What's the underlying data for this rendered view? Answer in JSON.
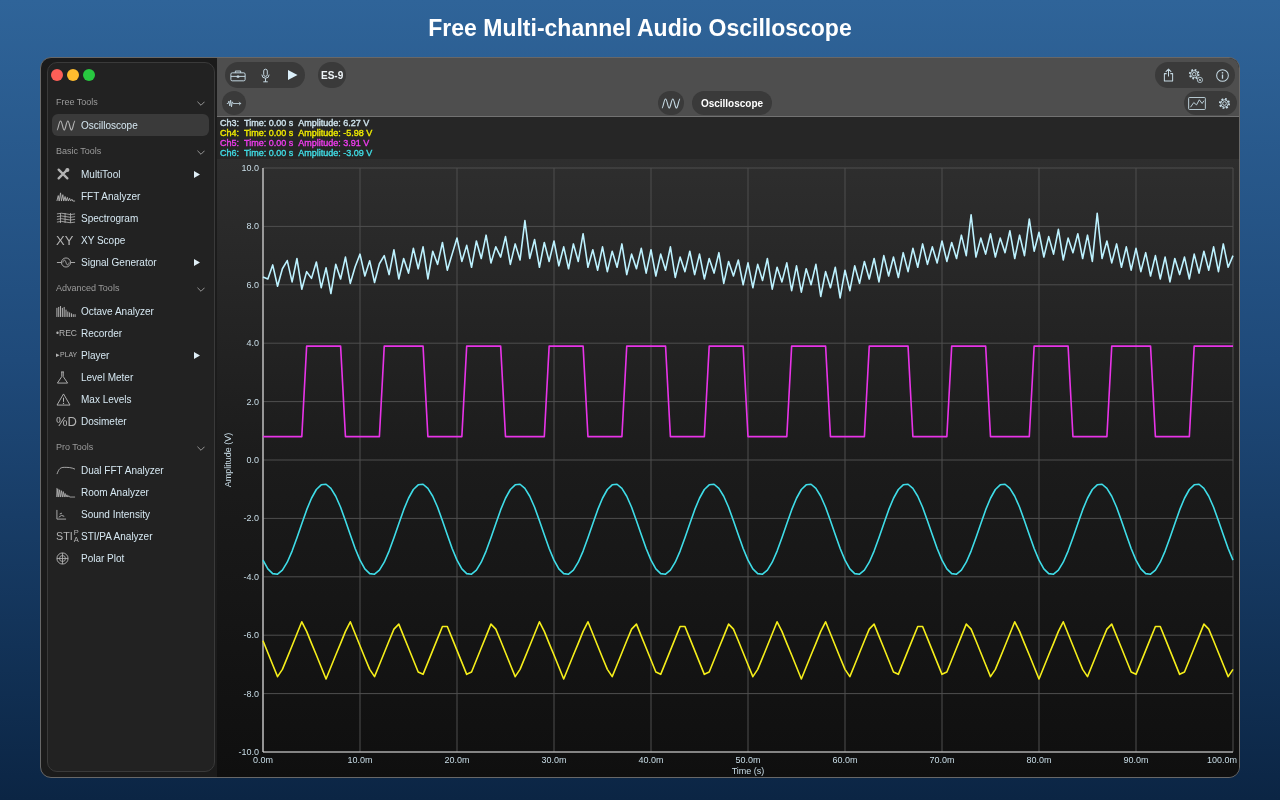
{
  "title": "Free Multi-channel Audio Oscilloscope",
  "sidebar": {
    "sections": [
      {
        "title": "Free Tools",
        "expanded": true,
        "items": [
          {
            "label": "Oscilloscope",
            "selected": true,
            "submenu": false
          }
        ]
      },
      {
        "title": "Basic Tools",
        "expanded": true,
        "items": [
          {
            "label": "MultiTool",
            "selected": false,
            "submenu": true
          },
          {
            "label": "FFT Analyzer",
            "selected": false,
            "submenu": false
          },
          {
            "label": "Spectrogram",
            "selected": false,
            "submenu": false
          },
          {
            "label": "XY Scope",
            "icon_text": "XY",
            "selected": false,
            "submenu": false
          },
          {
            "label": "Signal Generator",
            "selected": false,
            "submenu": true
          }
        ]
      },
      {
        "title": "Advanced Tools",
        "expanded": true,
        "items": [
          {
            "label": "Octave Analyzer",
            "selected": false,
            "submenu": false
          },
          {
            "label": "Recorder",
            "icon_text": "•REC",
            "selected": false,
            "submenu": false
          },
          {
            "label": "Player",
            "icon_text": "▸PLAY",
            "selected": false,
            "submenu": true
          },
          {
            "label": "Level Meter",
            "selected": false,
            "submenu": false
          },
          {
            "label": "Max Levels",
            "selected": false,
            "submenu": false
          },
          {
            "label": "Dosimeter",
            "icon_text": "%D",
            "selected": false,
            "submenu": false
          }
        ]
      },
      {
        "title": "Pro Tools",
        "expanded": true,
        "items": [
          {
            "label": "Dual FFT Analyzer",
            "selected": false,
            "submenu": false
          },
          {
            "label": "Room Analyzer",
            "selected": false,
            "submenu": false
          },
          {
            "label": "Sound Intensity",
            "selected": false,
            "submenu": false
          },
          {
            "label": "STI/PA Analyzer",
            "icon_text": "STI",
            "icon_text_small": "PA",
            "selected": false,
            "submenu": false
          },
          {
            "label": "Polar Plot",
            "selected": false,
            "submenu": false
          }
        ]
      }
    ]
  },
  "toolbar": {
    "device_button": "ES-9",
    "tool_title": "Oscilloscope"
  },
  "oscilloscope": {
    "readouts": [
      {
        "channel": "Ch3:",
        "time": "Time: 0.00 s",
        "amplitude": "Amplitude: 6.27 V",
        "color": "#cfe4ee"
      },
      {
        "channel": "Ch4:",
        "time": "Time: 0.00 s",
        "amplitude": "Amplitude: -5.98 V",
        "color": "#f0ec00"
      },
      {
        "channel": "Ch5:",
        "time": "Time: 0.00 s",
        "amplitude": "Amplitude: 3.91 V",
        "color": "#ee3cee"
      },
      {
        "channel": "Ch6:",
        "time": "Time: 0.00 s",
        "amplitude": "Amplitude: -3.09 V",
        "color": "#40dde6"
      }
    ],
    "chart_data": {
      "type": "line",
      "xlabel": "Time (s)",
      "ylabel": "Amplitude (V)",
      "grid": true,
      "xlim": [
        0,
        100
      ],
      "ylim": [
        -10,
        10
      ],
      "xticks": [
        {
          "value": 0,
          "label": "0.0m"
        },
        {
          "value": 10,
          "label": "10.0m"
        },
        {
          "value": 20,
          "label": "20.0m"
        },
        {
          "value": 30,
          "label": "30.0m"
        },
        {
          "value": 40,
          "label": "40.0m"
        },
        {
          "value": 50,
          "label": "50.0m"
        },
        {
          "value": 60,
          "label": "60.0m"
        },
        {
          "value": 70,
          "label": "70.0m"
        },
        {
          "value": 80,
          "label": "80.0m"
        },
        {
          "value": 90,
          "label": "90.0m"
        },
        {
          "value": 100,
          "label": "100.0m"
        }
      ],
      "yticks": [
        {
          "value": 10,
          "label": "10.0"
        },
        {
          "value": 8,
          "label": "8.0"
        },
        {
          "value": 6,
          "label": "6.0"
        },
        {
          "value": 4,
          "label": "4.0"
        },
        {
          "value": 2,
          "label": "2.0"
        },
        {
          "value": 0,
          "label": "0.0"
        },
        {
          "value": -2,
          "label": "-2.0"
        },
        {
          "value": -4,
          "label": "-4.0"
        },
        {
          "value": -6,
          "label": "-6.0"
        },
        {
          "value": -8,
          "label": "-8.0"
        },
        {
          "value": -10,
          "label": "-10.0"
        }
      ],
      "x": [
        0,
        0.5,
        1,
        1.5,
        2,
        2.5,
        3,
        3.5,
        4,
        4.5,
        5,
        5.5,
        6,
        6.5,
        7,
        7.5,
        8,
        8.5,
        9,
        9.5,
        10,
        10.5,
        11,
        11.5,
        12,
        12.5,
        13,
        13.5,
        14,
        14.5,
        15,
        15.5,
        16,
        16.5,
        17,
        17.5,
        18,
        18.5,
        19,
        19.5,
        20,
        20.5,
        21,
        21.5,
        22,
        22.5,
        23,
        23.5,
        24,
        24.5,
        25,
        25.5,
        26,
        26.5,
        27,
        27.5,
        28,
        28.5,
        29,
        29.5,
        30,
        30.5,
        31,
        31.5,
        32,
        32.5,
        33,
        33.5,
        34,
        34.5,
        35,
        35.5,
        36,
        36.5,
        37,
        37.5,
        38,
        38.5,
        39,
        39.5,
        40,
        40.5,
        41,
        41.5,
        42,
        42.5,
        43,
        43.5,
        44,
        44.5,
        45,
        45.5,
        46,
        46.5,
        47,
        47.5,
        48,
        48.5,
        49,
        49.5,
        50,
        50.5,
        51,
        51.5,
        52,
        52.5,
        53,
        53.5,
        54,
        54.5,
        55,
        55.5,
        56,
        56.5,
        57,
        57.5,
        58,
        58.5,
        59,
        59.5,
        60,
        60.5,
        61,
        61.5,
        62,
        62.5,
        63,
        63.5,
        64,
        64.5,
        65,
        65.5,
        66,
        66.5,
        67,
        67.5,
        68,
        68.5,
        69,
        69.5,
        70,
        70.5,
        71,
        71.5,
        72,
        72.5,
        73,
        73.5,
        74,
        74.5,
        75,
        75.5,
        76,
        76.5,
        77,
        77.5,
        78,
        78.5,
        79,
        79.5,
        80,
        80.5,
        81,
        81.5,
        82,
        82.5,
        83,
        83.5,
        84,
        84.5,
        85,
        85.5,
        86,
        86.5,
        87,
        87.5,
        88,
        88.5,
        89,
        89.5,
        90,
        90.5,
        91,
        91.5,
        92,
        92.5,
        93,
        93.5,
        94,
        94.5,
        95,
        95.5,
        96,
        96.5,
        97,
        97.5,
        98,
        98.5,
        99,
        99.5,
        100
      ],
      "series": [
        {
          "color": "#bdf2ff",
          "values": [
            6.27,
            6.2,
            6.68,
            5.95,
            6.55,
            6.83,
            6.1,
            6.9,
            5.85,
            6.45,
            6.22,
            6.78,
            5.9,
            6.58,
            5.7,
            6.7,
            6.2,
            6.95,
            6.05,
            6.62,
            7.05,
            6.3,
            6.82,
            6.08,
            6.72,
            7.0,
            6.35,
            7.2,
            6.2,
            6.9,
            6.4,
            7.25,
            6.55,
            7.3,
            6.2,
            7.15,
            6.7,
            7.45,
            6.5,
            7.05,
            7.6,
            6.8,
            7.35,
            6.6,
            7.5,
            6.9,
            7.7,
            6.75,
            7.3,
            6.95,
            7.65,
            6.7,
            7.4,
            6.85,
            8.2,
            6.9,
            7.55,
            6.6,
            7.45,
            6.8,
            7.5,
            6.65,
            7.3,
            6.55,
            7.4,
            6.8,
            7.75,
            6.6,
            7.2,
            6.5,
            7.3,
            6.45,
            7.15,
            6.6,
            7.4,
            6.35,
            7.05,
            6.55,
            7.25,
            6.4,
            7.2,
            6.3,
            7.05,
            6.5,
            7.3,
            6.25,
            6.95,
            6.45,
            7.15,
            6.35,
            7.05,
            6.2,
            6.9,
            6.4,
            7.1,
            6.05,
            6.8,
            6.3,
            6.85,
            6.0,
            6.75,
            5.9,
            6.7,
            6.15,
            6.9,
            5.85,
            6.6,
            6.1,
            6.75,
            5.8,
            6.65,
            5.75,
            6.55,
            6.0,
            6.7,
            5.6,
            6.45,
            5.9,
            6.6,
            5.55,
            6.5,
            5.8,
            6.65,
            6.05,
            6.8,
            6.2,
            6.9,
            6.1,
            7.0,
            6.3,
            6.95,
            6.25,
            7.1,
            6.45,
            7.25,
            6.6,
            7.4,
            6.7,
            7.3,
            6.75,
            7.5,
            6.8,
            7.45,
            6.9,
            7.7,
            7.0,
            8.4,
            6.95,
            7.6,
            7.05,
            7.75,
            6.95,
            7.6,
            7.1,
            7.85,
            6.9,
            7.7,
            7.0,
            8.25,
            7.15,
            7.8,
            6.95,
            7.65,
            7.05,
            7.9,
            6.85,
            7.6,
            7.1,
            7.75,
            6.9,
            7.7,
            6.8,
            8.45,
            6.9,
            7.5,
            6.75,
            7.4,
            6.6,
            7.3,
            6.5,
            7.25,
            6.45,
            7.1,
            6.3,
            7.0,
            6.2,
            6.95,
            6.1,
            6.9,
            6.35,
            6.95,
            6.2,
            7.05,
            6.4,
            7.15,
            6.5,
            7.3,
            6.45,
            7.4,
            6.6,
            7.0
          ]
        },
        {
          "color": "#f5ee1a",
          "values": [
            -6.19,
            -6.6,
            -7.01,
            -7.42,
            -7.17,
            -6.77,
            -6.36,
            -5.95,
            -5.54,
            -5.87,
            -6.28,
            -6.68,
            -7.09,
            -7.5,
            -7.09,
            -6.68,
            -6.28,
            -5.87,
            -5.54,
            -5.95,
            -6.36,
            -6.77,
            -7.17,
            -7.42,
            -7.01,
            -6.6,
            -6.19,
            -5.79,
            -5.62,
            -6.03,
            -6.44,
            -6.85,
            -7.26,
            -7.34,
            -6.93,
            -6.52,
            -6.11,
            -5.7,
            -5.7,
            -6.11,
            -6.52,
            -6.93,
            -7.34,
            -7.26,
            -6.85,
            -6.44,
            -6.03,
            -5.62,
            -5.79,
            -6.19,
            -6.6,
            -7.01,
            -7.42,
            -7.17,
            -6.77,
            -6.36,
            -5.95,
            -5.54,
            -5.87,
            -6.28,
            -6.68,
            -7.09,
            -7.5,
            -7.09,
            -6.68,
            -6.28,
            -5.87,
            -5.54,
            -5.95,
            -6.36,
            -6.77,
            -7.17,
            -7.42,
            -7.01,
            -6.6,
            -6.19,
            -5.79,
            -5.62,
            -6.03,
            -6.44,
            -6.85,
            -7.26,
            -7.34,
            -6.93,
            -6.52,
            -6.11,
            -5.7,
            -5.7,
            -6.11,
            -6.52,
            -6.93,
            -7.34,
            -7.26,
            -6.85,
            -6.44,
            -6.03,
            -5.62,
            -5.79,
            -6.19,
            -6.6,
            -7.01,
            -7.42,
            -7.17,
            -6.77,
            -6.36,
            -5.95,
            -5.54,
            -5.87,
            -6.28,
            -6.68,
            -7.09,
            -7.5,
            -7.09,
            -6.68,
            -6.28,
            -5.87,
            -5.54,
            -5.95,
            -6.36,
            -6.77,
            -7.17,
            -7.42,
            -7.01,
            -6.6,
            -6.19,
            -5.79,
            -5.62,
            -6.03,
            -6.44,
            -6.85,
            -7.26,
            -7.34,
            -6.93,
            -6.52,
            -6.11,
            -5.7,
            -5.7,
            -6.11,
            -6.52,
            -6.93,
            -7.34,
            -7.26,
            -6.85,
            -6.44,
            -6.03,
            -5.62,
            -5.79,
            -6.19,
            -6.6,
            -7.01,
            -7.42,
            -7.17,
            -6.77,
            -6.36,
            -5.95,
            -5.54,
            -5.87,
            -6.28,
            -6.68,
            -7.09,
            -7.5,
            -7.09,
            -6.68,
            -6.28,
            -5.87,
            -5.54,
            -5.95,
            -6.36,
            -6.77,
            -7.17,
            -7.42,
            -7.01,
            -6.6,
            -6.19,
            -5.79,
            -5.62,
            -6.03,
            -6.44,
            -6.85,
            -7.26,
            -7.34,
            -6.93,
            -6.52,
            -6.11,
            -5.7,
            -5.7,
            -6.11,
            -6.52,
            -6.93,
            -7.34,
            -7.26,
            -6.85,
            -6.44,
            -6.03,
            -5.62,
            -5.79,
            -6.19,
            -6.6,
            -7.01,
            -7.42,
            -7.17
          ]
        },
        {
          "color": "#e834e8",
          "values": [
            0.8,
            0.8,
            0.8,
            0.8,
            0.8,
            0.8,
            0.8,
            0.8,
            0.8,
            3.9,
            3.9,
            3.9,
            3.9,
            3.9,
            3.9,
            3.9,
            3.9,
            0.8,
            0.8,
            0.8,
            0.8,
            0.8,
            0.8,
            0.8,
            0.8,
            3.9,
            3.9,
            3.9,
            3.9,
            3.9,
            3.9,
            3.9,
            3.9,
            3.9,
            0.8,
            0.8,
            0.8,
            0.8,
            0.8,
            0.8,
            0.8,
            0.8,
            3.9,
            3.9,
            3.9,
            3.9,
            3.9,
            3.9,
            3.9,
            3.9,
            0.8,
            0.8,
            0.8,
            0.8,
            0.8,
            0.8,
            0.8,
            0.8,
            0.8,
            3.9,
            3.9,
            3.9,
            3.9,
            3.9,
            3.9,
            3.9,
            3.9,
            0.8,
            0.8,
            0.8,
            0.8,
            0.8,
            0.8,
            0.8,
            0.8,
            3.9,
            3.9,
            3.9,
            3.9,
            3.9,
            3.9,
            3.9,
            3.9,
            3.9,
            0.8,
            0.8,
            0.8,
            0.8,
            0.8,
            0.8,
            0.8,
            0.8,
            3.9,
            3.9,
            3.9,
            3.9,
            3.9,
            3.9,
            3.9,
            3.9,
            0.8,
            0.8,
            0.8,
            0.8,
            0.8,
            0.8,
            0.8,
            0.8,
            0.8,
            3.9,
            3.9,
            3.9,
            3.9,
            3.9,
            3.9,
            3.9,
            3.9,
            0.8,
            0.8,
            0.8,
            0.8,
            0.8,
            0.8,
            0.8,
            0.8,
            3.9,
            3.9,
            3.9,
            3.9,
            3.9,
            3.9,
            3.9,
            3.9,
            3.9,
            0.8,
            0.8,
            0.8,
            0.8,
            0.8,
            0.8,
            0.8,
            0.8,
            3.9,
            3.9,
            3.9,
            3.9,
            3.9,
            3.9,
            3.9,
            3.9,
            0.8,
            0.8,
            0.8,
            0.8,
            0.8,
            0.8,
            0.8,
            0.8,
            0.8,
            3.9,
            3.9,
            3.9,
            3.9,
            3.9,
            3.9,
            3.9,
            3.9,
            0.8,
            0.8,
            0.8,
            0.8,
            0.8,
            0.8,
            0.8,
            0.8,
            3.9,
            3.9,
            3.9,
            3.9,
            3.9,
            3.9,
            3.9,
            3.9,
            3.9,
            0.8,
            0.8,
            0.8,
            0.8,
            0.8,
            0.8,
            0.8,
            0.8,
            3.9,
            3.9,
            3.9,
            3.9,
            3.9,
            3.9,
            3.9,
            3.9,
            3.9
          ]
        },
        {
          "color": "#3fdde8",
          "values": [
            -3.43,
            -3.73,
            -3.89,
            -3.91,
            -3.77,
            -3.5,
            -3.12,
            -2.66,
            -2.18,
            -1.71,
            -1.31,
            -1.01,
            -0.85,
            -0.83,
            -0.97,
            -1.24,
            -1.62,
            -2.08,
            -2.56,
            -3.03,
            -3.43,
            -3.73,
            -3.89,
            -3.91,
            -3.77,
            -3.5,
            -3.12,
            -2.66,
            -2.18,
            -1.71,
            -1.31,
            -1.01,
            -0.85,
            -0.83,
            -0.97,
            -1.24,
            -1.62,
            -2.08,
            -2.56,
            -3.03,
            -3.43,
            -3.73,
            -3.89,
            -3.91,
            -3.77,
            -3.5,
            -3.12,
            -2.66,
            -2.18,
            -1.71,
            -1.31,
            -1.01,
            -0.85,
            -0.83,
            -0.97,
            -1.24,
            -1.62,
            -2.08,
            -2.56,
            -3.03,
            -3.43,
            -3.73,
            -3.89,
            -3.91,
            -3.77,
            -3.5,
            -3.12,
            -2.66,
            -2.18,
            -1.71,
            -1.31,
            -1.01,
            -0.85,
            -0.83,
            -0.97,
            -1.24,
            -1.62,
            -2.08,
            -2.56,
            -3.03,
            -3.43,
            -3.73,
            -3.89,
            -3.91,
            -3.77,
            -3.5,
            -3.12,
            -2.66,
            -2.18,
            -1.71,
            -1.31,
            -1.01,
            -0.85,
            -0.83,
            -0.97,
            -1.24,
            -1.62,
            -2.08,
            -2.56,
            -3.03,
            -3.43,
            -3.73,
            -3.89,
            -3.91,
            -3.77,
            -3.5,
            -3.12,
            -2.66,
            -2.18,
            -1.71,
            -1.31,
            -1.01,
            -0.85,
            -0.83,
            -0.97,
            -1.24,
            -1.62,
            -2.08,
            -2.56,
            -3.03,
            -3.43,
            -3.73,
            -3.89,
            -3.91,
            -3.77,
            -3.5,
            -3.12,
            -2.66,
            -2.18,
            -1.71,
            -1.31,
            -1.01,
            -0.85,
            -0.83,
            -0.97,
            -1.24,
            -1.62,
            -2.08,
            -2.56,
            -3.03,
            -3.43,
            -3.73,
            -3.89,
            -3.91,
            -3.77,
            -3.5,
            -3.12,
            -2.66,
            -2.18,
            -1.71,
            -1.31,
            -1.01,
            -0.85,
            -0.83,
            -0.97,
            -1.24,
            -1.62,
            -2.08,
            -2.56,
            -3.03,
            -3.43,
            -3.73,
            -3.89,
            -3.91,
            -3.77,
            -3.5,
            -3.12,
            -2.66,
            -2.18,
            -1.71,
            -1.31,
            -1.01,
            -0.85,
            -0.83,
            -0.97,
            -1.24,
            -1.62,
            -2.08,
            -2.56,
            -3.03,
            -3.43,
            -3.73,
            -3.89,
            -3.91,
            -3.77,
            -3.5,
            -3.12,
            -2.66,
            -2.18,
            -1.71,
            -1.31,
            -1.01,
            -0.85,
            -0.83,
            -0.97,
            -1.24,
            -1.62,
            -2.08,
            -2.56,
            -3.03,
            -3.43
          ]
        }
      ]
    }
  }
}
